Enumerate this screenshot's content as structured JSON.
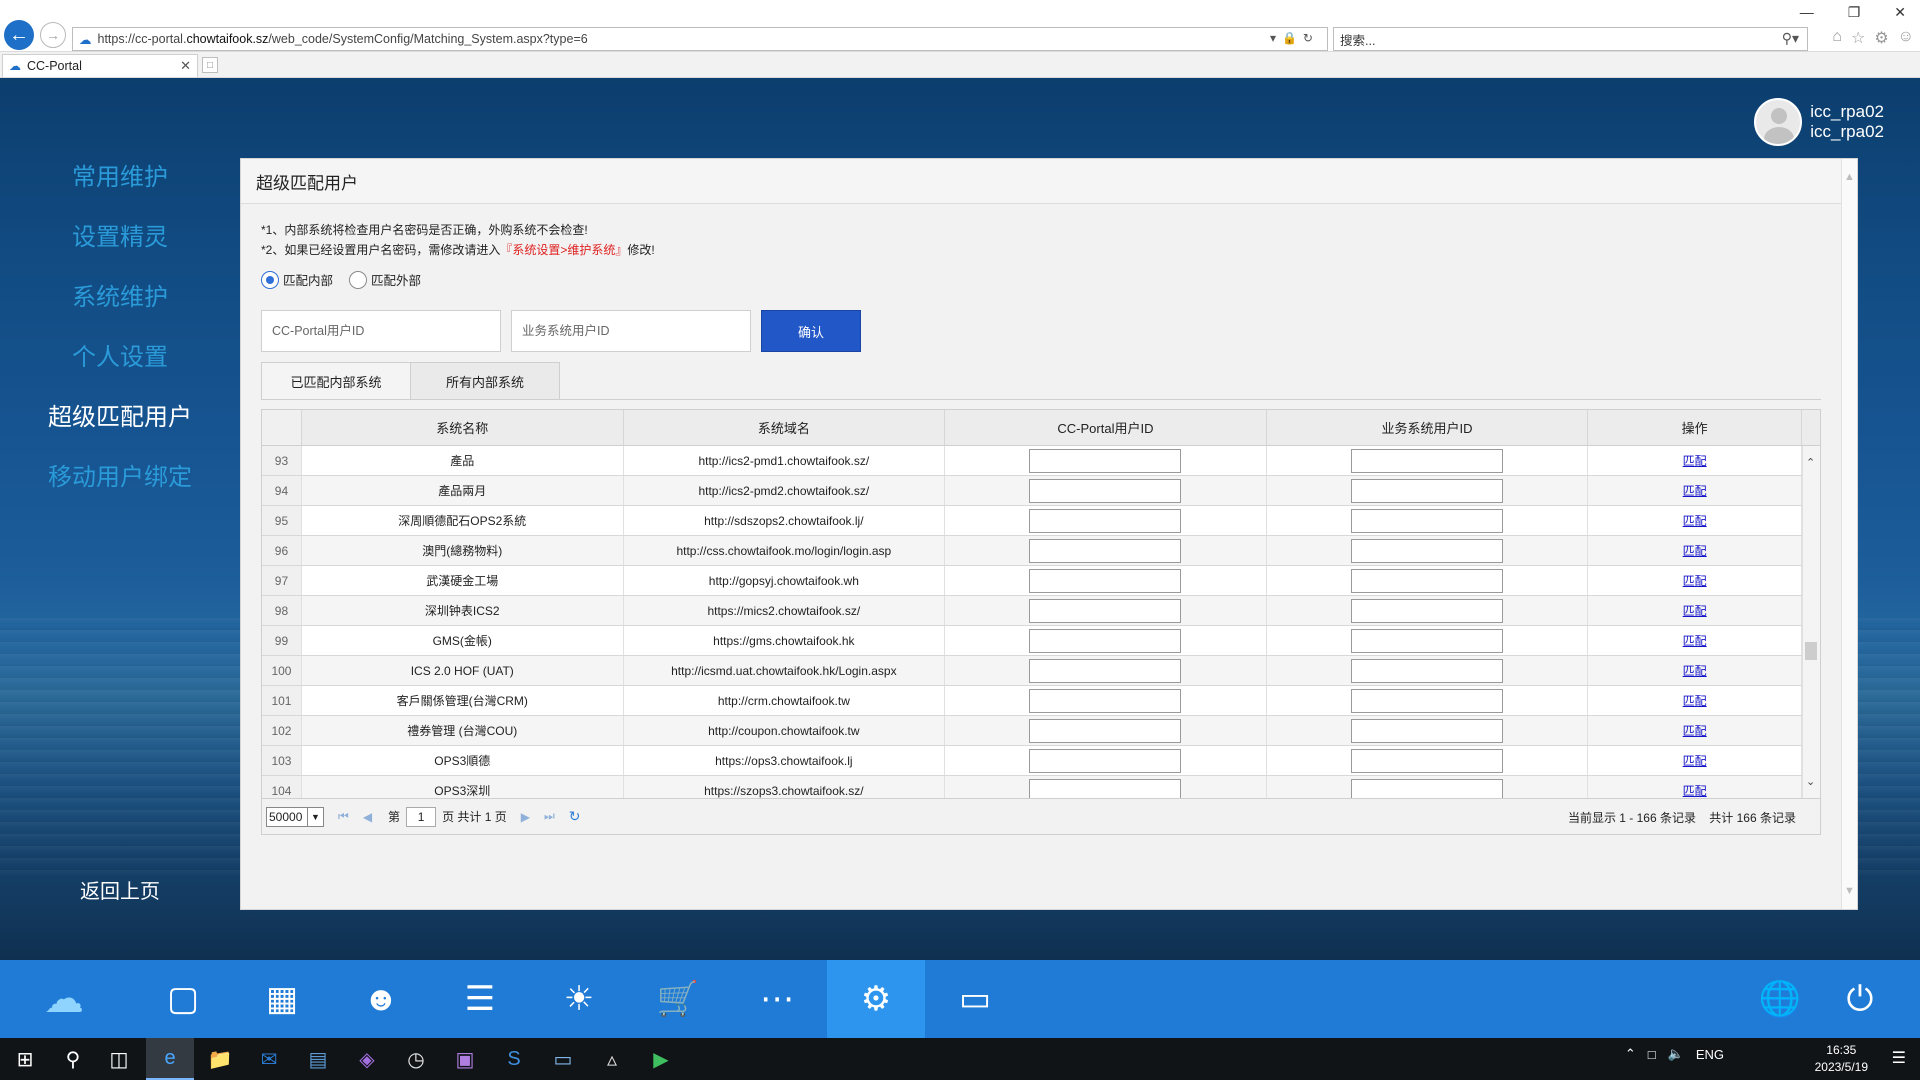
{
  "browser": {
    "url_prefix": "https://cc-portal.",
    "url_domain": "chowtaifook.sz",
    "url_path": "/web_code/SystemConfig/Matching_System.aspx?type=6",
    "search_placeholder": "搜索...",
    "tab_title": "CC-Portal",
    "window_controls": [
      "—",
      "❐",
      "✕"
    ]
  },
  "user": {
    "name_line1": "icc_rpa02",
    "name_line2": "icc_rpa02"
  },
  "nav": {
    "items": [
      {
        "label": "常用维护"
      },
      {
        "label": "设置精灵"
      },
      {
        "label": "系统维护"
      },
      {
        "label": "个人设置"
      },
      {
        "label": "超级匹配用户"
      },
      {
        "label": "移动用户绑定"
      }
    ],
    "back_label": "返回上页"
  },
  "panel": {
    "title": "超级匹配用户",
    "note1": "*1、内部系统将检查用户名密码是否正确，外购系统不会检查!",
    "note2_prefix": "*2、如果已经设置用户名密码，需修改请进入",
    "note2_link": "『系统设置>维护系统』",
    "note2_suffix": "修改!",
    "radio_internal": "匹配内部",
    "radio_external": "匹配外部",
    "input_cc_placeholder": "CC-Portal用户ID",
    "input_biz_placeholder": "业务系统用户ID",
    "confirm_label": "确认",
    "tab_matched": "已匹配内部系统",
    "tab_all": "所有内部系统"
  },
  "grid": {
    "columns": [
      "系统名称",
      "系统域名",
      "CC-Portal用户ID",
      "业务系统用户ID",
      "操作"
    ],
    "op_label": "匹配",
    "rows": [
      {
        "no": "93",
        "name": "產品",
        "domain": "http://ics2-pmd1.chowtaifook.sz/"
      },
      {
        "no": "94",
        "name": "產品兩月",
        "domain": "http://ics2-pmd2.chowtaifook.sz/"
      },
      {
        "no": "95",
        "name": "深周順德配石OPS2系統",
        "domain": "http://sdszops2.chowtaifook.lj/"
      },
      {
        "no": "96",
        "name": "澳門(總務物料)",
        "domain": "http://css.chowtaifook.mo/login/login.asp"
      },
      {
        "no": "97",
        "name": "武漢硬金工場",
        "domain": "http://gopsyj.chowtaifook.wh"
      },
      {
        "no": "98",
        "name": "深圳钟表ICS2",
        "domain": "https://mics2.chowtaifook.sz/"
      },
      {
        "no": "99",
        "name": "GMS(金帳)",
        "domain": "https://gms.chowtaifook.hk"
      },
      {
        "no": "100",
        "name": "ICS 2.0 HOF (UAT)",
        "domain": "http://icsmd.uat.chowtaifook.hk/Login.aspx"
      },
      {
        "no": "101",
        "name": "客戶關係管理(台灣CRM)",
        "domain": "http://crm.chowtaifook.tw"
      },
      {
        "no": "102",
        "name": "禮券管理 (台灣COU)",
        "domain": "http://coupon.chowtaifook.tw"
      },
      {
        "no": "103",
        "name": "OPS3順德",
        "domain": "https://ops3.chowtaifook.lj"
      },
      {
        "no": "104",
        "name": "OPS3深圳",
        "domain": "https://szops3.chowtaifook.sz/"
      }
    ]
  },
  "pager": {
    "page_size": "50000",
    "page_prefix": "第",
    "current_page": "1",
    "page_suffix": "页 共计 1 页",
    "info": "当前显示 1 - 166 条记录    共计 166 条记录"
  },
  "app_bar": {
    "icons": [
      "cloud-logo-icon",
      "id-card-icon",
      "apps-grid-icon",
      "users-icon",
      "finance-list-icon",
      "weather-settings-icon",
      "cart-icon",
      "chat-icon",
      "settings-icon",
      "monitor-icon",
      "globe-icon",
      "power-icon"
    ],
    "active": "settings-icon"
  },
  "taskbar": {
    "language": "ENG",
    "time": "16:35",
    "date": "2023/5/19"
  },
  "colors": {
    "primary_button": "#2257c8",
    "app_bar": "#1f7bd6",
    "nav_inactive": "#2a9ad8",
    "link": "#1414c8",
    "warning": "#e02020"
  }
}
